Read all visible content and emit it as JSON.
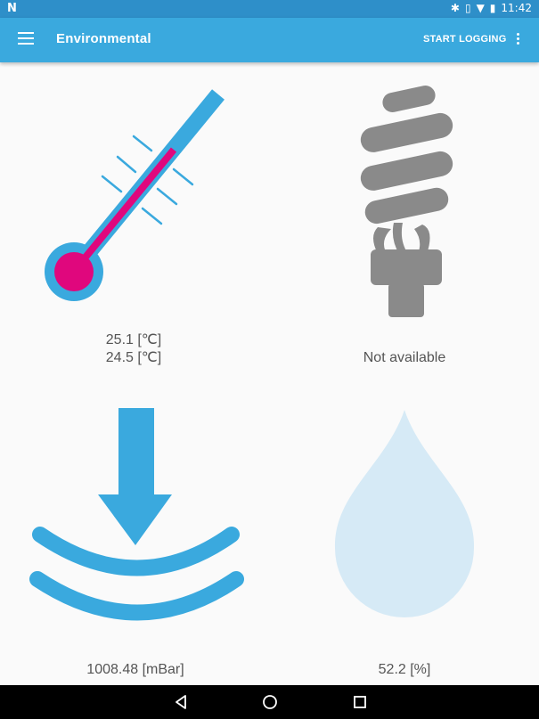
{
  "statusbar": {
    "time": "11:42",
    "notification": "N"
  },
  "appbar": {
    "title": "Environmental",
    "action_label": "START LOGGING"
  },
  "colors": {
    "primary": "#3aa9de",
    "primary_dark": "#2e8fc9",
    "accent": "#e0077d",
    "gray_icon": "#8a8a8a",
    "drop": "#d6eaf6"
  },
  "sensors": {
    "temperature": {
      "icon": "thermometer-icon",
      "line1": "25.1 [℃]",
      "line2": "24.5 [℃]"
    },
    "luminosity": {
      "icon": "lightbulb-icon",
      "value": "Not available"
    },
    "pressure": {
      "icon": "pressure-icon",
      "value": "1008.48 [mBar]"
    },
    "humidity": {
      "icon": "drop-icon",
      "value": "52.2 [%]"
    }
  }
}
